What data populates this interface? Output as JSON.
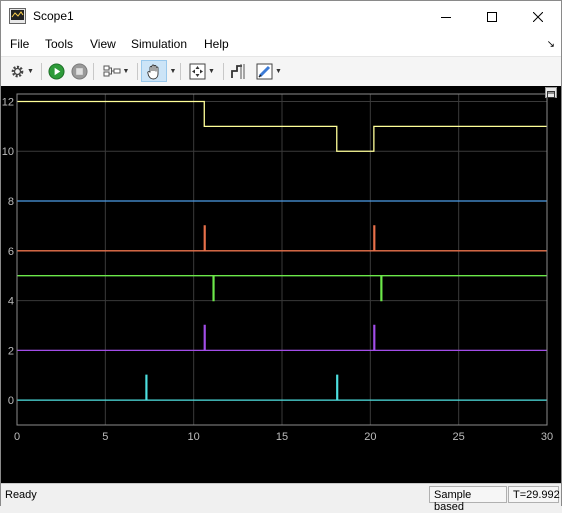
{
  "window": {
    "title": "Scope1"
  },
  "menu": [
    {
      "key": "file",
      "label": "File"
    },
    {
      "key": "tools",
      "label": "Tools"
    },
    {
      "key": "view",
      "label": "View"
    },
    {
      "key": "simulation",
      "label": "Simulation"
    },
    {
      "key": "help",
      "label": "Help"
    }
  ],
  "menu_dock_glyph": "↘",
  "toolbar": {
    "icons": [
      "gear-icon",
      "run-icon",
      "stop-icon",
      "signal-selector-icon",
      "pan-hand-icon",
      "autoscale-icon",
      "cursor-measure-icon",
      "highlight-icon"
    ]
  },
  "status": {
    "ready": "Ready",
    "mode": "Sample based",
    "time": "T=29.992"
  },
  "chart_data": {
    "type": "line",
    "xlim": [
      0,
      30
    ],
    "ylim": [
      -1,
      12.3
    ],
    "x_ticks": [
      0,
      5,
      10,
      15,
      20,
      25,
      30
    ],
    "y_ticks": [
      0,
      2,
      4,
      6,
      8,
      10,
      12
    ],
    "grid": true,
    "background": "#000000",
    "series": [
      {
        "color": "#ffff99",
        "points": [
          [
            0,
            12
          ],
          [
            10.6,
            12
          ],
          [
            10.6,
            11
          ],
          [
            18.1,
            11
          ],
          [
            18.1,
            10
          ],
          [
            20.2,
            10
          ],
          [
            20.2,
            11
          ],
          [
            30,
            11
          ]
        ]
      },
      {
        "color": "#4d9ce6",
        "points": [
          [
            0,
            8
          ],
          [
            30,
            8
          ]
        ]
      },
      {
        "color": "#e8704a",
        "points": [
          [
            0,
            6
          ],
          [
            10.6,
            6
          ],
          [
            10.6,
            7
          ],
          [
            10.65,
            7
          ],
          [
            10.65,
            6
          ],
          [
            20.2,
            6
          ],
          [
            20.2,
            7
          ],
          [
            20.25,
            7
          ],
          [
            20.25,
            6
          ],
          [
            30,
            6
          ]
        ]
      },
      {
        "color": "#6ce84a",
        "points": [
          [
            0,
            5
          ],
          [
            11.1,
            5
          ],
          [
            11.1,
            4
          ],
          [
            11.15,
            4
          ],
          [
            11.15,
            5
          ],
          [
            20.6,
            5
          ],
          [
            20.6,
            4
          ],
          [
            20.65,
            4
          ],
          [
            20.65,
            5
          ],
          [
            30,
            5
          ]
        ]
      },
      {
        "color": "#a24de8",
        "points": [
          [
            0,
            2
          ],
          [
            10.6,
            2
          ],
          [
            10.6,
            3
          ],
          [
            10.65,
            3
          ],
          [
            10.65,
            2
          ],
          [
            20.2,
            2
          ],
          [
            20.2,
            3
          ],
          [
            20.25,
            3
          ],
          [
            20.25,
            2
          ],
          [
            30,
            2
          ]
        ]
      },
      {
        "color": "#4de0e0",
        "points": [
          [
            0,
            0
          ],
          [
            7.3,
            0
          ],
          [
            7.3,
            1
          ],
          [
            7.35,
            1
          ],
          [
            7.35,
            0
          ],
          [
            18.1,
            0
          ],
          [
            18.1,
            1
          ],
          [
            18.15,
            1
          ],
          [
            18.15,
            0
          ],
          [
            30,
            0
          ]
        ]
      }
    ]
  }
}
